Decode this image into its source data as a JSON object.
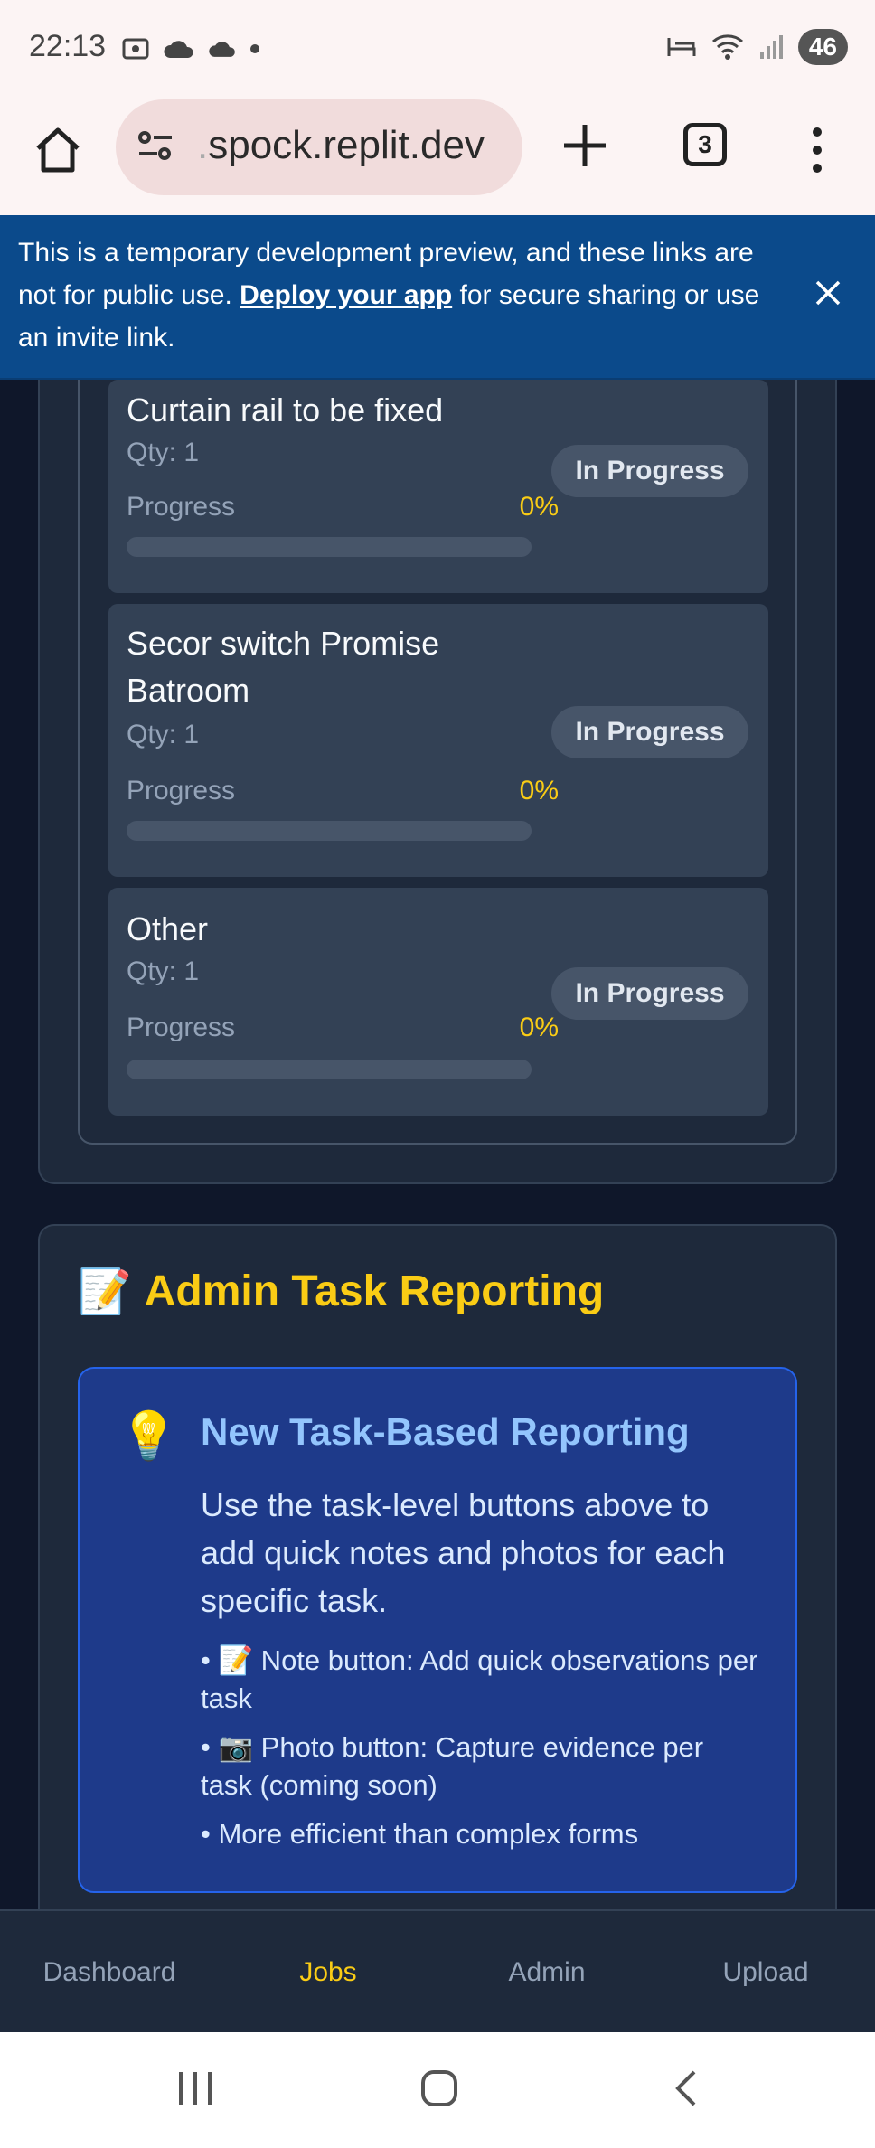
{
  "status_bar": {
    "time": "22:13",
    "battery": "46",
    "left_icons": [
      "screenshot-icon",
      "cloud-icon",
      "cloud-icon",
      "dot-icon"
    ],
    "right_icons": [
      "sleep-icon",
      "wifi-icon",
      "signal-icon"
    ]
  },
  "browser": {
    "url_prefix": ".",
    "url": "spock.replit.dev",
    "tab_count": "3"
  },
  "dev_banner": {
    "text_before": "This is a temporary development preview, and these links are not for public use. ",
    "link": "Deploy your app",
    "text_after": " for secure sharing or use an invite link."
  },
  "tasks": [
    {
      "title": "Curtain rail to be fixed",
      "qty": "Qty: 1",
      "progress_label": "Progress",
      "progress_pct": "0%",
      "progress": 0,
      "status": "In Progress"
    },
    {
      "title": "Secor switch Promise Batroom",
      "qty": "Qty: 1",
      "progress_label": "Progress",
      "progress_pct": "0%",
      "progress": 0,
      "status": "In Progress"
    },
    {
      "title": "Other",
      "qty": "Qty: 1",
      "progress_label": "Progress",
      "progress_pct": "0%",
      "progress": 0,
      "status": "In Progress"
    }
  ],
  "admin": {
    "title_emoji": "📝",
    "title": "Admin Task Reporting",
    "info": {
      "emoji": "💡",
      "heading": "New Task-Based Reporting",
      "body": "Use the task-level buttons above to add quick notes and photos for each specific task.",
      "items": [
        "• 📝 Note button: Add quick observations per task",
        "• 📷 Photo button: Capture evidence per task (coming soon)",
        "• More efficient than complex forms"
      ]
    }
  },
  "bottom_nav": {
    "items": [
      "Dashboard",
      "Jobs",
      "Admin",
      "Upload"
    ],
    "active": "Jobs"
  },
  "colors": {
    "accent": "#facc15",
    "background": "#0f172a",
    "card": "#1e293b",
    "task_card": "#334155",
    "banner": "#0b4a8b",
    "info_box": "#1e3a8a"
  }
}
